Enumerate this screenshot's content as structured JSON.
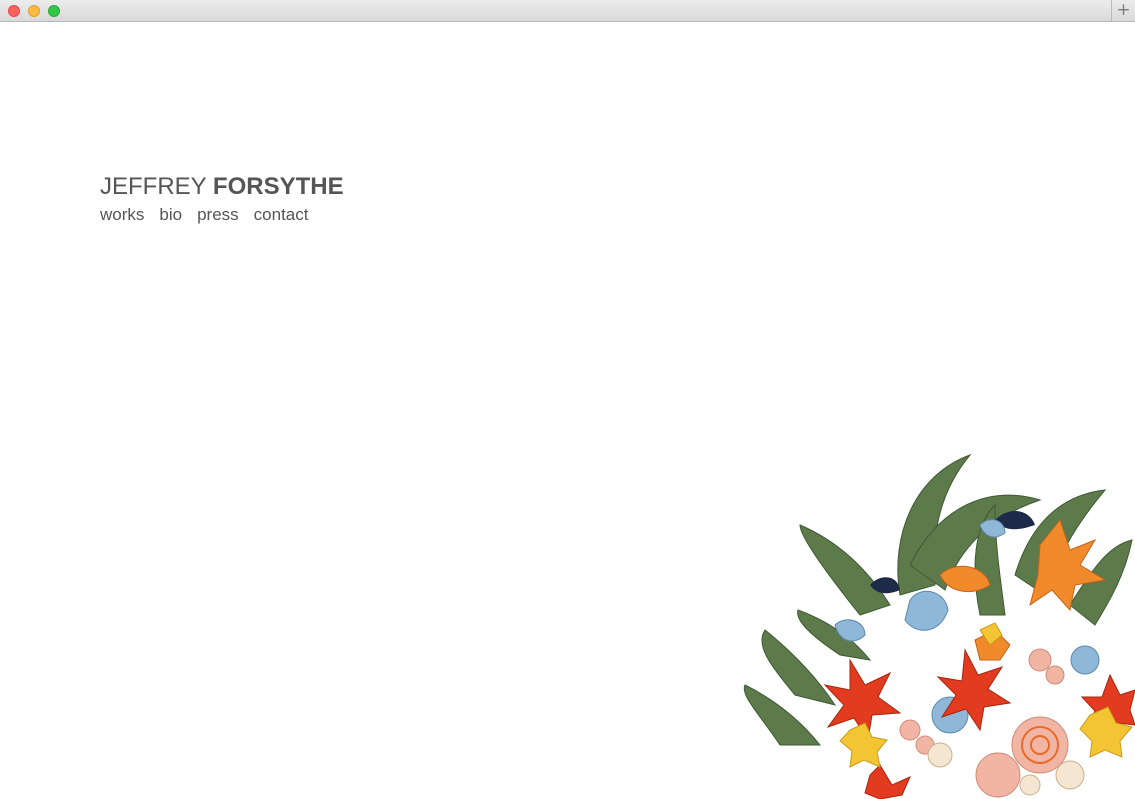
{
  "window": {
    "new_tab_symbol": "+"
  },
  "header": {
    "first_name": "JEFFREY",
    "last_name": "FORSYTHE"
  },
  "nav": {
    "items": [
      "works",
      "bio",
      "press",
      "contact"
    ]
  },
  "artwork": {
    "description_icon": "flower-bouquet-illustration",
    "palette": {
      "leaf": "#5d7a4a",
      "leaf_dark": "#3f5a34",
      "red": "#e23b1f",
      "orange": "#f08a2a",
      "yellow": "#f4c533",
      "blue": "#8fb8d8",
      "pink": "#f2b5a4",
      "navy": "#1d2a48",
      "cream": "#f4e6d0"
    }
  }
}
